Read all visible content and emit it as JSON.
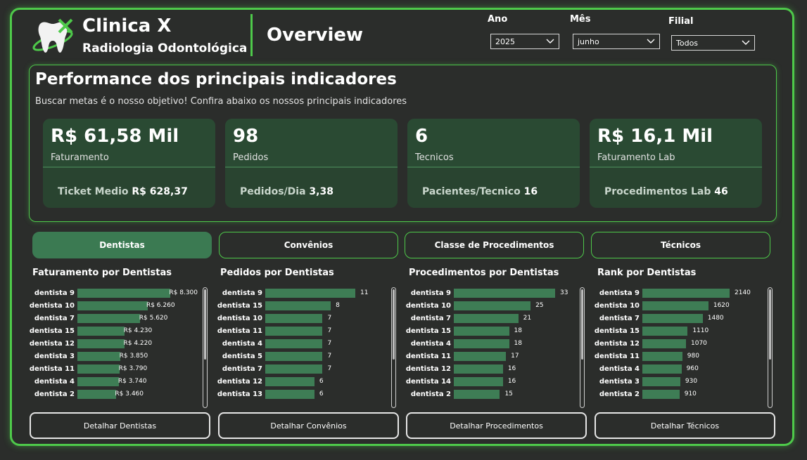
{
  "header": {
    "brand_title": "Clinica X",
    "brand_subtitle": "Radiologia Odontológica",
    "page_title": "Overview"
  },
  "filters": [
    {
      "label": "Ano",
      "value": "2025"
    },
    {
      "label": "Mês",
      "value": "junho"
    },
    {
      "label": "Filial",
      "value": "Todos"
    }
  ],
  "kpi_section": {
    "title": "Performance dos principais indicadores",
    "subtitle": "Buscar metas é o nosso objetivo! Confira abaixo os nossos principais indicadores",
    "cards": [
      {
        "value": "R$ 61,58 Mil",
        "label": "Faturamento",
        "secondary_label": "Ticket Medio",
        "secondary_value": "R$ 628,37"
      },
      {
        "value": "98",
        "label": "Pedidos",
        "secondary_label": "Pedidos/Dia",
        "secondary_value": "3,38"
      },
      {
        "value": "6",
        "label": "Tecnicos",
        "secondary_label": "Pacientes/Tecnico",
        "secondary_value": "16"
      },
      {
        "value": "R$ 16,1 Mil",
        "label": "Faturamento Lab",
        "secondary_label": "Procedimentos Lab",
        "secondary_value": "46"
      }
    ]
  },
  "tabs": [
    {
      "label": "Dentistas",
      "active": true
    },
    {
      "label": "Convênios",
      "active": false
    },
    {
      "label": "Classe de Procedimentos",
      "active": false
    },
    {
      "label": "Técnicos",
      "active": false
    }
  ],
  "detail_buttons": [
    "Detalhar Dentistas",
    "Detalhar Convênios",
    "Detalhar Procedimentos",
    "Detalhar Técnicos"
  ],
  "colors": {
    "accent": "#4ec94a",
    "bar": "#3e7d55",
    "card": "#2a4a33",
    "background": "#2b2d2b"
  },
  "chart_data": [
    {
      "type": "bar",
      "title": "Faturamento por Dentistas",
      "categories": [
        "dentista 9",
        "dentista 10",
        "dentista 7",
        "dentista 15",
        "dentista 12",
        "dentista 3",
        "dentista 11",
        "dentista 4",
        "dentista 2"
      ],
      "values": [
        8300,
        6260,
        5620,
        4230,
        4220,
        3850,
        3790,
        3740,
        3460
      ],
      "labels": [
        "R$ 8.300",
        "R$ 6.260",
        "R$ 5.620",
        "R$ 4.230",
        "R$ 4.220",
        "R$ 3.850",
        "R$ 3.790",
        "R$ 3.740",
        "R$ 3.460"
      ]
    },
    {
      "type": "bar",
      "title": "Pedidos por Dentistas",
      "categories": [
        "dentista 9",
        "dentista 15",
        "dentista 10",
        "dentista 11",
        "dentista 4",
        "dentista 5",
        "dentista 7",
        "dentista 12",
        "dentista 13"
      ],
      "values": [
        11,
        8,
        7,
        7,
        7,
        7,
        7,
        6,
        6
      ],
      "labels": [
        "11",
        "8",
        "7",
        "7",
        "7",
        "7",
        "7",
        "6",
        "6"
      ]
    },
    {
      "type": "bar",
      "title": "Procedimentos por Dentistas",
      "categories": [
        "dentista 9",
        "dentista 10",
        "dentista 7",
        "dentista 15",
        "dentista 4",
        "dentista 11",
        "dentista 12",
        "dentista 14",
        "dentista 2"
      ],
      "values": [
        33,
        25,
        21,
        18,
        18,
        17,
        16,
        16,
        15
      ],
      "labels": [
        "33",
        "25",
        "21",
        "18",
        "18",
        "17",
        "16",
        "16",
        "15"
      ]
    },
    {
      "type": "bar",
      "title": "Rank por Dentistas",
      "categories": [
        "dentista 9",
        "dentista 10",
        "dentista 7",
        "dentista 15",
        "dentista 12",
        "dentista 11",
        "dentista 4",
        "dentista 3",
        "dentista 2"
      ],
      "values": [
        2140,
        1620,
        1480,
        1110,
        1070,
        980,
        960,
        930,
        910
      ],
      "labels": [
        "2140",
        "1620",
        "1480",
        "1110",
        "1070",
        "980",
        "960",
        "930",
        "910"
      ]
    }
  ]
}
